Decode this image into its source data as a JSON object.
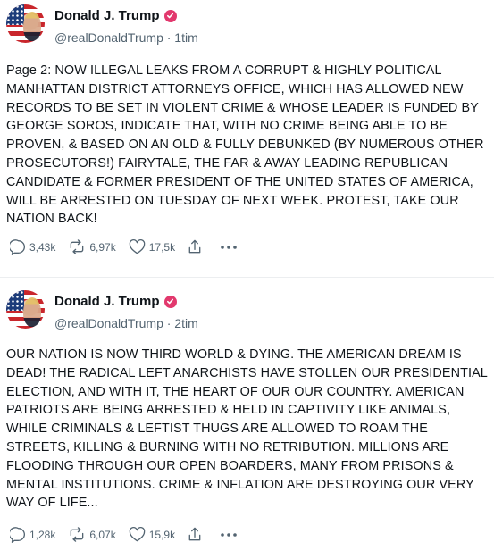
{
  "posts": [
    {
      "author_name": "Donald J. Trump",
      "handle_time": "@realDonaldTrump · 1tim",
      "text": "Page 2: NOW ILLEGAL LEAKS FROM A CORRUPT & HIGHLY POLITICAL MANHATTAN DISTRICT ATTORNEYS OFFICE, WHICH HAS ALLOWED NEW RECORDS TO BE SET IN VIOLENT CRIME & WHOSE LEADER IS FUNDED BY GEORGE SOROS, INDICATE THAT, WITH NO CRIME BEING ABLE TO BE PROVEN, & BASED ON AN OLD & FULLY DEBUNKED (BY NUMEROUS OTHER PROSECUTORS!) FAIRYTALE, THE FAR & AWAY LEADING REPUBLICAN CANDIDATE & FORMER PRESIDENT OF THE UNITED STATES OF AMERICA, WILL BE ARRESTED ON TUESDAY OF NEXT WEEK. PROTEST, TAKE OUR NATION BACK!",
      "replies": "3,43k",
      "reposts": "6,97k",
      "likes": "17,5k"
    },
    {
      "author_name": "Donald J. Trump",
      "handle_time": "@realDonaldTrump · 2tim",
      "text": "OUR NATION IS NOW THIRD WORLD & DYING. THE AMERICAN DREAM IS DEAD! THE RADICAL LEFT ANARCHISTS HAVE STOLLEN  OUR PRESIDENTIAL ELECTION, AND WITH IT, THE HEART OF OUR OUR COUNTRY. AMERICAN PATRIOTS ARE BEING ARRESTED & HELD IN CAPTIVITY LIKE ANIMALS, WHILE CRIMINALS & LEFTIST THUGS ARE ALLOWED TO ROAM THE STREETS, KILLING & BURNING WITH NO RETRIBUTION. MILLIONS ARE FLOODING THROUGH OUR OPEN BOARDERS, MANY FROM PRISONS & MENTAL INSTITUTIONS. CRIME & INFLATION ARE DESTROYING OUR VERY WAY OF LIFE...",
      "replies": "1,28k",
      "reposts": "6,07k",
      "likes": "15,9k"
    }
  ],
  "colors": {
    "verified_badge": "#e2386d",
    "secondary_text": "#536471",
    "primary_text": "#0f1419"
  },
  "icons": [
    "reply-icon",
    "repost-icon",
    "like-icon",
    "share-icon",
    "more-icon",
    "verified-badge-icon"
  ]
}
